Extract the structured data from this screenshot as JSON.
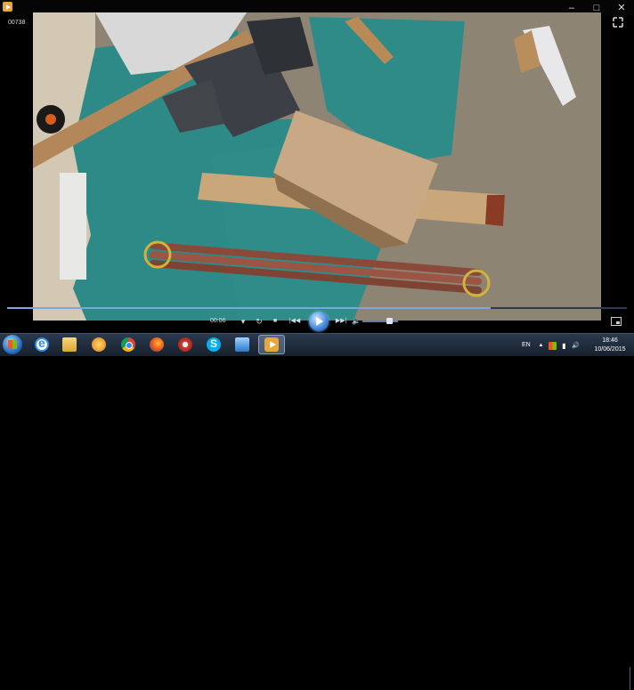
{
  "window": {
    "file_name": "00738",
    "controls": {
      "minimize": "–",
      "maximize": "□",
      "close": "✕"
    }
  },
  "player": {
    "elapsed": "00:06",
    "progress_fraction": 0.78,
    "volume_fraction": 0.8,
    "controls": {
      "menu": "▾",
      "stop": "■",
      "prev": "|◀◀",
      "next": "▶▶|",
      "volume": "🔈"
    }
  },
  "taskbar": {
    "items": [
      {
        "icon": "internet-explorer-icon"
      },
      {
        "icon": "folder-icon"
      },
      {
        "icon": "media-player-icon"
      },
      {
        "icon": "chrome-icon"
      },
      {
        "icon": "firefox-icon"
      },
      {
        "icon": "daemon-tools-icon"
      },
      {
        "icon": "skype-icon"
      },
      {
        "icon": "explorer-icon"
      },
      {
        "icon": "video-player-icon",
        "active": true
      }
    ],
    "language": "EN",
    "tray": {
      "arrow": "▲",
      "volume": "🔊"
    },
    "time": "18:46",
    "date": "10/06/2015"
  }
}
